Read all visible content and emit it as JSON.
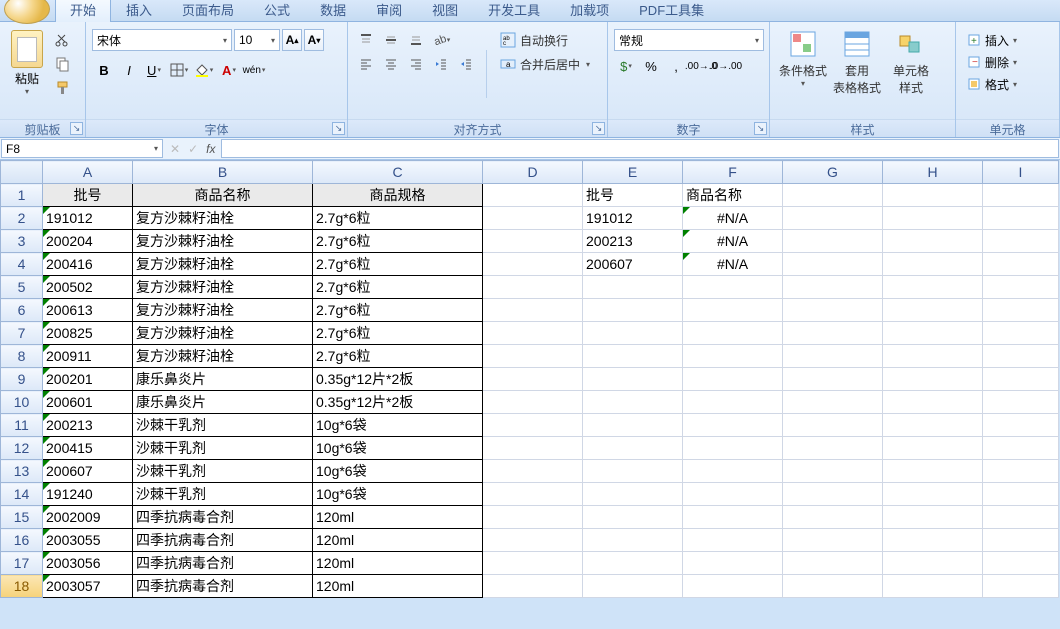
{
  "tabs": {
    "start": "开始",
    "insert": "插入",
    "pagelayout": "页面布局",
    "formulas": "公式",
    "data": "数据",
    "review": "审阅",
    "view": "视图",
    "developer": "开发工具",
    "addins": "加载项",
    "pdf": "PDF工具集"
  },
  "ribbon": {
    "clipboard": {
      "paste": "粘贴",
      "label": "剪贴板"
    },
    "font": {
      "name": "宋体",
      "size": "10",
      "label": "字体"
    },
    "alignment": {
      "wrap": "自动换行",
      "merge": "合并后居中",
      "label": "对齐方式"
    },
    "number": {
      "format": "常规",
      "label": "数字"
    },
    "styles": {
      "cond": "条件格式",
      "tablefmt": "套用\n表格格式",
      "cellstyle": "单元格\n样式",
      "label": "样式"
    },
    "cells": {
      "insert": "插入",
      "delete": "删除",
      "format": "格式",
      "label": "单元格"
    }
  },
  "namebox": "F8",
  "sheet1": {
    "headers": {
      "A": "批号",
      "B": "商品名称",
      "C": "商品规格"
    },
    "rows": [
      {
        "a": "191012",
        "b": "复方沙棘籽油栓",
        "c": "2.7g*6粒"
      },
      {
        "a": "200204",
        "b": "复方沙棘籽油栓",
        "c": "2.7g*6粒"
      },
      {
        "a": "200416",
        "b": "复方沙棘籽油栓",
        "c": "2.7g*6粒"
      },
      {
        "a": "200502",
        "b": "复方沙棘籽油栓",
        "c": "2.7g*6粒"
      },
      {
        "a": "200613",
        "b": "复方沙棘籽油栓",
        "c": "2.7g*6粒"
      },
      {
        "a": "200825",
        "b": "复方沙棘籽油栓",
        "c": "2.7g*6粒"
      },
      {
        "a": "200911",
        "b": "复方沙棘籽油栓",
        "c": "2.7g*6粒"
      },
      {
        "a": "200201",
        "b": "康乐鼻炎片",
        "c": "0.35g*12片*2板"
      },
      {
        "a": "200601",
        "b": "康乐鼻炎片",
        "c": "0.35g*12片*2板"
      },
      {
        "a": "200213",
        "b": "沙棘干乳剂",
        "c": "10g*6袋"
      },
      {
        "a": "200415",
        "b": "沙棘干乳剂",
        "c": "10g*6袋"
      },
      {
        "a": "200607",
        "b": "沙棘干乳剂",
        "c": "10g*6袋"
      },
      {
        "a": "191240",
        "b": "沙棘干乳剂",
        "c": "10g*6袋"
      },
      {
        "a": "2002009",
        "b": "四季抗病毒合剂",
        "c": "120ml"
      },
      {
        "a": "2003055",
        "b": "四季抗病毒合剂",
        "c": "120ml"
      },
      {
        "a": "2003056",
        "b": "四季抗病毒合剂",
        "c": "120ml"
      },
      {
        "a": "2003057",
        "b": "四季抗病毒合剂",
        "c": "120ml"
      }
    ]
  },
  "sheet2": {
    "headers": {
      "E": "批号",
      "F": "商品名称"
    },
    "rows": [
      {
        "e": "191012",
        "f": "#N/A"
      },
      {
        "e": "200213",
        "f": "#N/A"
      },
      {
        "e": "200607",
        "f": "#N/A"
      }
    ]
  },
  "colLetters": [
    "A",
    "B",
    "C",
    "D",
    "E",
    "F",
    "G",
    "H",
    "I"
  ]
}
